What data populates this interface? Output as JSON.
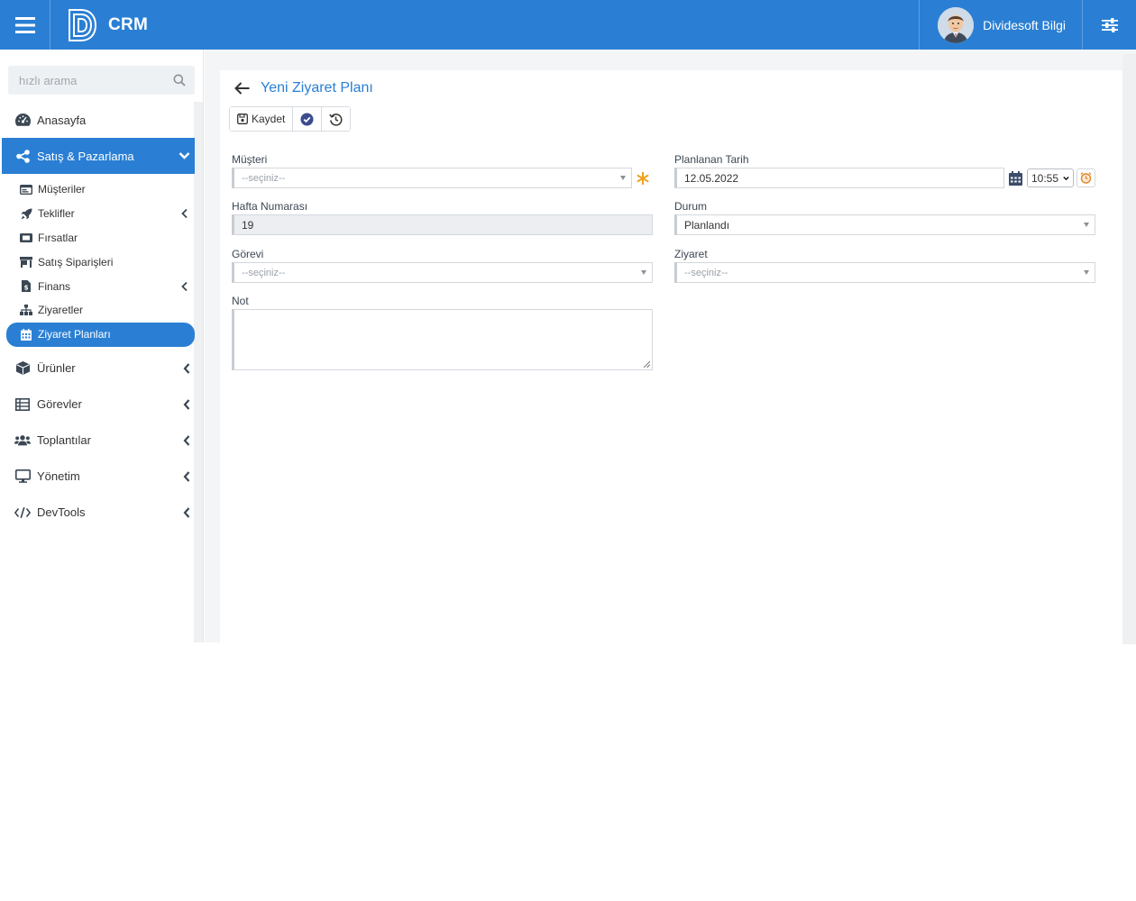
{
  "header": {
    "app_name": "CRM",
    "user_name": "Dividesoft Bilgi",
    "brand_color": "#2a7fd4"
  },
  "sidebar": {
    "search_placeholder": "hızlı arama",
    "items": [
      {
        "label": "Anasayfa",
        "icon": "dashboard-icon"
      },
      {
        "label": "Satış & Pazarlama",
        "icon": "share-icon",
        "active": true,
        "expanded": true
      },
      {
        "label": "Ürünler",
        "icon": "box-icon"
      },
      {
        "label": "Görevler",
        "icon": "table-list-icon"
      },
      {
        "label": "Toplantılar",
        "icon": "users-icon"
      },
      {
        "label": "Yönetim",
        "icon": "desktop-icon"
      },
      {
        "label": "DevTools",
        "icon": "code-icon"
      }
    ],
    "sub_items": [
      {
        "label": "Müşteriler",
        "icon": "address-card-icon"
      },
      {
        "label": "Teklifler",
        "icon": "rocket-icon"
      },
      {
        "label": "Fırsatlar",
        "icon": "ticket-icon"
      },
      {
        "label": "Satış Siparişleri",
        "icon": "store-icon"
      },
      {
        "label": "Finans",
        "icon": "file-invoice-icon"
      },
      {
        "label": "Ziyaretler",
        "icon": "sitemap-icon"
      },
      {
        "label": "Ziyaret Planları",
        "icon": "calendar-icon",
        "active": true
      }
    ]
  },
  "page": {
    "title": "Yeni Ziyaret Planı",
    "toolbar": {
      "save_label": "Kaydet"
    }
  },
  "form": {
    "musteri": {
      "label": "Müşteri",
      "placeholder": "--seçiniz--"
    },
    "planlanan_tarih": {
      "label": "Planlanan Tarih",
      "date": "12.05.2022",
      "time": "10:55"
    },
    "hafta_numarasi": {
      "label": "Hafta Numarası",
      "value": "19"
    },
    "durum": {
      "label": "Durum",
      "value": "Planlandı"
    },
    "gorevi": {
      "label": "Görevi",
      "placeholder": "--seçiniz--"
    },
    "ziyaret": {
      "label": "Ziyaret",
      "placeholder": "--seçiniz--"
    },
    "not": {
      "label": "Not",
      "value": ""
    }
  }
}
